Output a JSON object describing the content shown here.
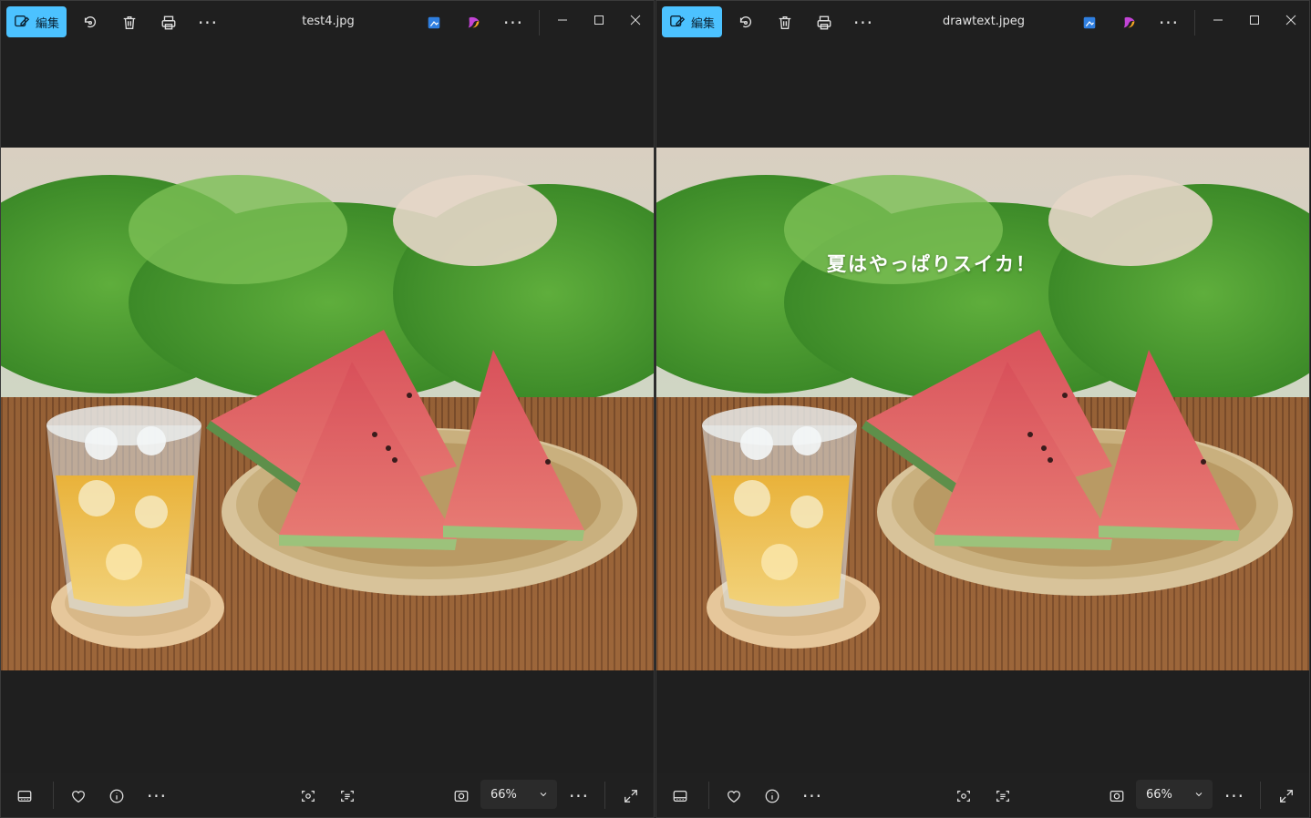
{
  "windows": [
    {
      "edit_label": "編集",
      "filename": "test4.jpg",
      "overlay_text": "",
      "zoom": "66%"
    },
    {
      "edit_label": "編集",
      "filename": "drawtext.jpeg",
      "overlay_text": "夏はやっぱりスイカ！",
      "zoom": "66%"
    }
  ],
  "icons": {
    "toolbar": [
      "edit-icon",
      "rotate-icon",
      "trash-icon",
      "print-icon",
      "more-icon",
      "designer-icon",
      "copilot-icon",
      "more-icon",
      "minimize-icon",
      "maximize-icon",
      "close-icon"
    ],
    "bottom": [
      "filmstrip-icon",
      "favorite-icon",
      "info-icon",
      "more-icon",
      "visual-search-icon",
      "text-scan-icon",
      "fit-to-window-icon",
      "chevron-down-icon",
      "more-icon",
      "fullscreen-icon"
    ]
  },
  "colors": {
    "accent": "#4cc2ff",
    "background": "#1f1f1f"
  }
}
